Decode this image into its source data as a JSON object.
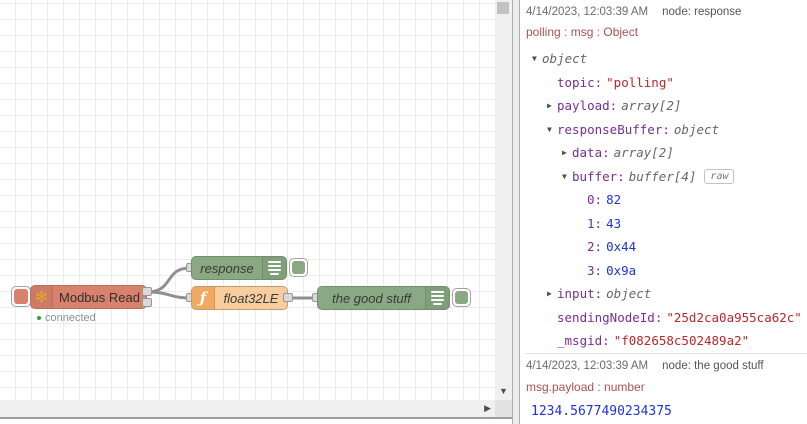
{
  "flow": {
    "modbus_node": {
      "label": "Modbus Read",
      "status_text": "connected",
      "icon": "✻"
    },
    "response_node": {
      "label": "response"
    },
    "function_node": {
      "label": "float32LE",
      "icon": "ƒ"
    },
    "goodstuff_node": {
      "label": "the good stuff"
    },
    "colors": {
      "modbus_fill": "#d8826e",
      "debug_fill": "#8aa883",
      "function_fill": "#f8cd9e",
      "function_icon_fill": "#f1a95f",
      "status_green": "#35a04a",
      "wire": "#8f8f8f"
    }
  },
  "scrollbars": {
    "down_arrow": "▼",
    "right_arrow": "▶"
  },
  "debug_panel": {
    "colors": {
      "key": "#792e90",
      "string": "#b72828",
      "number": "#2033d6",
      "meta": "#666666",
      "topic": "#aa5252"
    },
    "messages": [
      {
        "timestamp": "4/14/2023, 12:03:39 AM",
        "node": "node: response",
        "topic_line": "polling : msg : Object",
        "tree": [
          {
            "indent": 0,
            "exp": "open",
            "key": "",
            "value": "object",
            "vtype": "meta"
          },
          {
            "indent": 1,
            "exp": "none",
            "key": "topic",
            "value": "\"polling\"",
            "vtype": "string"
          },
          {
            "indent": 1,
            "exp": "closed",
            "key": "payload",
            "value": "array[2]",
            "vtype": "meta"
          },
          {
            "indent": 1,
            "exp": "open",
            "key": "responseBuffer",
            "value": "object",
            "vtype": "meta"
          },
          {
            "indent": 2,
            "exp": "closed",
            "key": "data",
            "value": "array[2]",
            "vtype": "meta"
          },
          {
            "indent": 2,
            "exp": "open",
            "key": "buffer",
            "value": "buffer[4]",
            "vtype": "meta",
            "raw": "raw"
          },
          {
            "indent": 3,
            "exp": "none",
            "key": "0",
            "value": "82",
            "vtype": "number"
          },
          {
            "indent": 3,
            "exp": "none",
            "key": "1",
            "value": "43",
            "vtype": "number"
          },
          {
            "indent": 3,
            "exp": "none",
            "key": "2",
            "value": "0x44",
            "vtype": "number"
          },
          {
            "indent": 3,
            "exp": "none",
            "key": "3",
            "value": "0x9a",
            "vtype": "number"
          },
          {
            "indent": 1,
            "exp": "closed",
            "key": "input",
            "value": "object",
            "vtype": "meta"
          },
          {
            "indent": 1,
            "exp": "none",
            "key": "sendingNodeId",
            "value": "\"25d2ca0a955ca62c\"",
            "vtype": "string"
          },
          {
            "indent": 1,
            "exp": "none",
            "key": "_msgid",
            "value": "\"f082658c502489a2\"",
            "vtype": "string"
          }
        ]
      },
      {
        "timestamp": "4/14/2023, 12:03:39 AM",
        "node": "node: the good stuff",
        "topic_line": "msg.payload : number",
        "payload_value": "1234.5677490234375"
      }
    ]
  }
}
